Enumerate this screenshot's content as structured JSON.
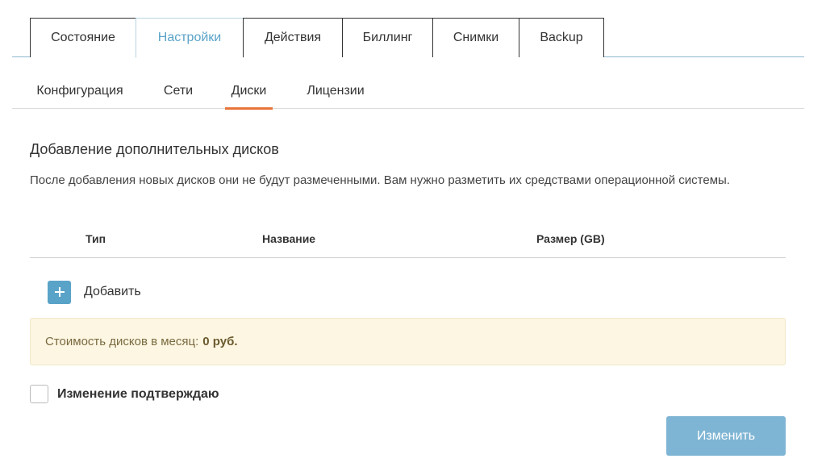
{
  "top_tabs": [
    {
      "label": "Состояние"
    },
    {
      "label": "Настройки"
    },
    {
      "label": "Действия"
    },
    {
      "label": "Биллинг"
    },
    {
      "label": "Снимки"
    },
    {
      "label": "Backup"
    }
  ],
  "top_tabs_active": "Настройки",
  "sub_tabs": [
    {
      "label": "Конфигурация"
    },
    {
      "label": "Сети"
    },
    {
      "label": "Диски"
    },
    {
      "label": "Лицензии"
    }
  ],
  "sub_tabs_active": "Диски",
  "section": {
    "title": "Добавление дополнительных дисков",
    "description": "После добавления новых дисков они не будут размеченными. Вам нужно разметить их средствами операционной системы."
  },
  "table": {
    "columns": [
      "Тип",
      "Название",
      "Размер (GB)"
    ]
  },
  "add": {
    "icon": "plus-icon",
    "label": "Добавить"
  },
  "cost": {
    "label": "Стоимость дисков в месяц:",
    "value": "0 руб."
  },
  "confirm": {
    "label": "Изменение подтверждаю",
    "checked": false
  },
  "submit": {
    "label": "Изменить"
  },
  "colors": {
    "accent": "#5aa3c8",
    "active_underline": "#e8743b",
    "cost_background": "#fcf6e2",
    "submit_button": "#7fb5d4"
  }
}
